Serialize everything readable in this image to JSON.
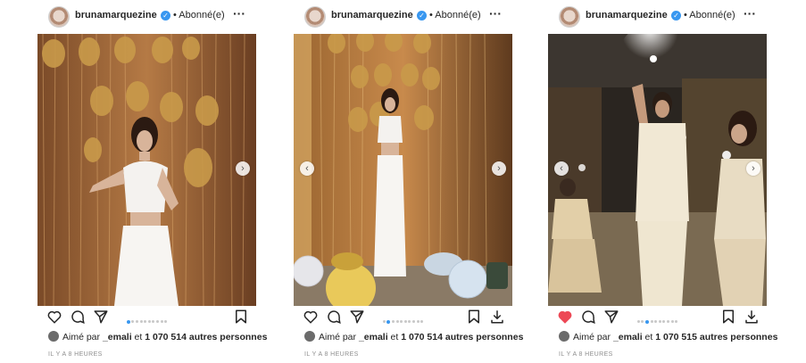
{
  "posts": [
    {
      "username": "brunamarquezine",
      "verified_mark": "✓",
      "follow_status": "• Abonné(e)",
      "more_icon": "more-dots-icon",
      "liked": false,
      "carousel_dots": 10,
      "carousel_active": 0,
      "show_prev_arrow": false,
      "show_next_arrow": true,
      "show_save_download": false,
      "likes_prefix": "Aimé par ",
      "likes_user": "_emali",
      "likes_middle": " et ",
      "likes_count": "1 070 514",
      "likes_suffix": " autres personnes",
      "time": "IL Y A 8 HEURES"
    },
    {
      "username": "brunamarquezine",
      "verified_mark": "✓",
      "follow_status": "• Abonné(e)",
      "more_icon": "more-dots-icon",
      "liked": false,
      "carousel_dots": 10,
      "carousel_active": 1,
      "show_prev_arrow": true,
      "show_next_arrow": true,
      "show_save_download": true,
      "likes_prefix": "Aimé par ",
      "likes_user": "_emali",
      "likes_middle": " et ",
      "likes_count": "1 070 514",
      "likes_suffix": " autres personnes",
      "time": "IL Y A 8 HEURES"
    },
    {
      "username": "brunamarquezine",
      "verified_mark": "✓",
      "follow_status": "• Abonné(e)",
      "more_icon": "more-dots-icon",
      "liked": true,
      "carousel_dots": 10,
      "carousel_active": 2,
      "show_prev_arrow": true,
      "show_next_arrow": true,
      "show_save_download": true,
      "likes_prefix": "Aimé par ",
      "likes_user": "_emali",
      "likes_middle": " et ",
      "likes_count": "1 070 515",
      "likes_suffix": " autres personnes",
      "time": "IL Y A 8 HEURES"
    }
  ],
  "colors": {
    "verified": "#3897f0",
    "liked_heart": "#ed4956",
    "dot_active": "#3897f0",
    "dot_inactive": "#c8c8c8",
    "text": "#262626",
    "muted": "#8e8e8e"
  },
  "icons": {
    "like": "heart-icon",
    "comment": "comment-bubble-icon",
    "share": "paper-plane-icon",
    "save": "bookmark-icon",
    "download": "download-icon",
    "prev": "chevron-left-icon",
    "next": "chevron-right-icon"
  },
  "photos": [
    {
      "description_icon": "party-photo-1"
    },
    {
      "description_icon": "party-photo-2"
    },
    {
      "description_icon": "party-photo-3"
    }
  ]
}
